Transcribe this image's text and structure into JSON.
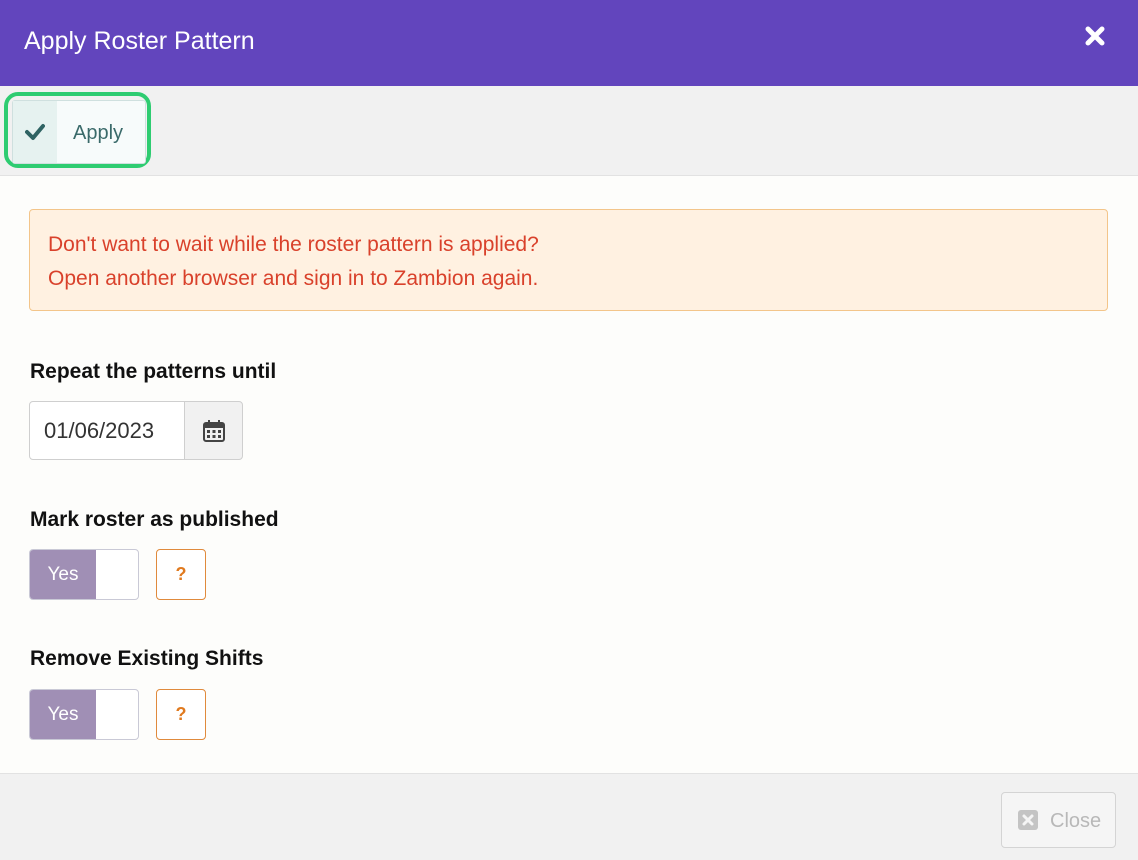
{
  "dialog": {
    "title": "Apply Roster Pattern",
    "close_icon": "close-icon"
  },
  "toolbar": {
    "apply_label": "Apply",
    "apply_icon": "check-icon"
  },
  "alert": {
    "line1": "Don't want to wait while the roster pattern is applied?",
    "line2": "Open another browser and sign in to Zambion again."
  },
  "repeat": {
    "label": "Repeat the patterns until",
    "date_value": "01/06/2023",
    "calendar_icon": "calendar-icon"
  },
  "publish": {
    "label": "Mark roster as published",
    "toggle_label": "Yes",
    "help_label": "?"
  },
  "remove": {
    "label": "Remove Existing Shifts",
    "toggle_label": "Yes",
    "help_label": "?"
  },
  "footer": {
    "close_label": "Close",
    "close_icon": "close-square-icon"
  },
  "colors": {
    "header": "#6245bd",
    "highlight": "#2ecc71",
    "alert_text": "#d9412b",
    "alert_bg": "#fff1e1",
    "toggle_on": "#a08fb5",
    "help": "#e07a1f"
  }
}
